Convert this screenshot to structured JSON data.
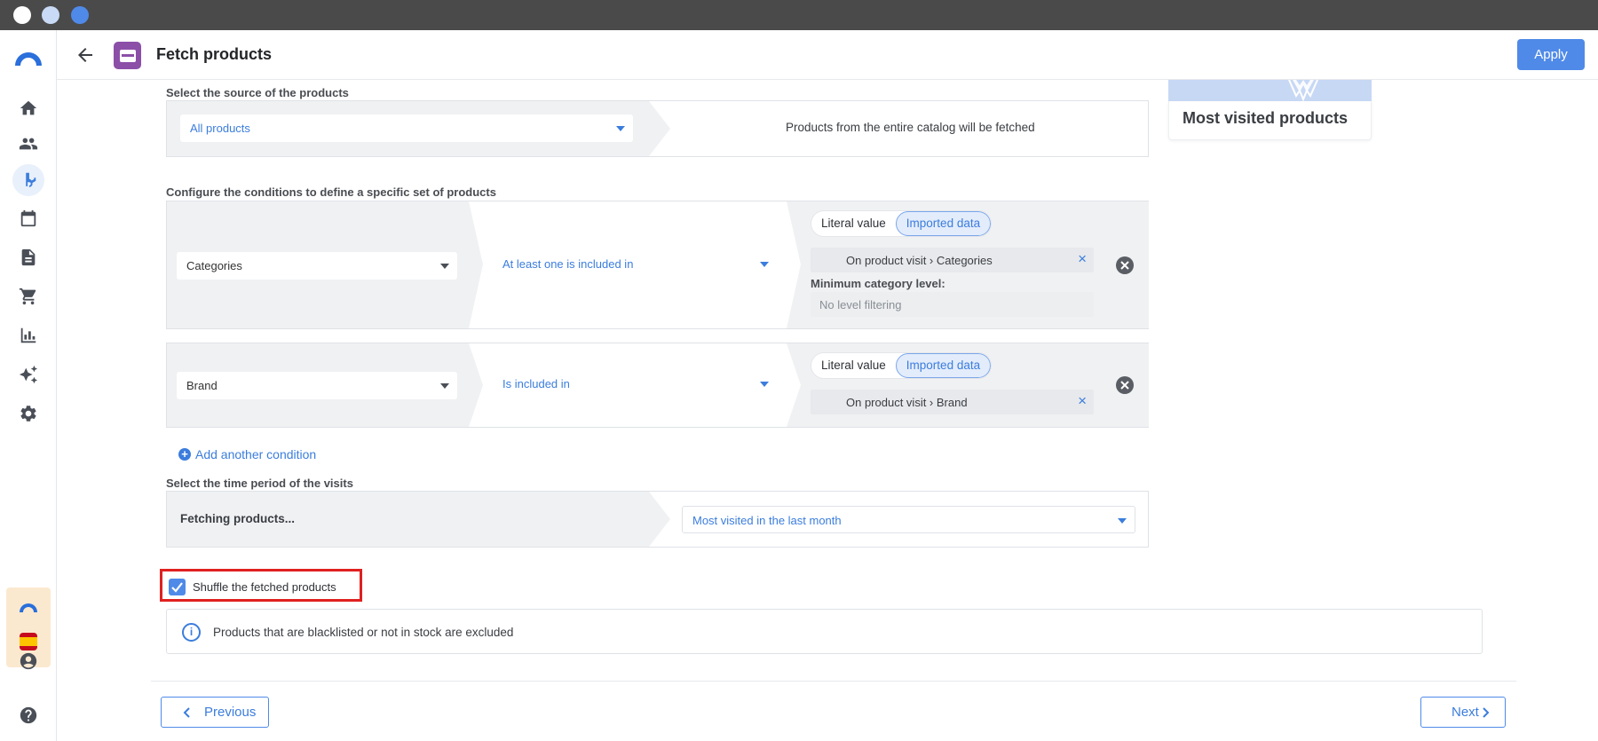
{
  "header": {
    "title": "Fetch products",
    "apply_label": "Apply"
  },
  "preview_card": {
    "title": "Most visited products"
  },
  "source": {
    "label": "Select the source of the products",
    "selected": "All products",
    "description": "Products from the entire catalog will be fetched"
  },
  "conditions": {
    "label": "Configure the conditions to define a specific set of products",
    "items": [
      {
        "field": "Categories",
        "operator": "At least one is included in",
        "toggle": [
          "Literal value",
          "Imported data"
        ],
        "toggle_selected": "Imported data",
        "value_chip": "On product visit › Categories",
        "min_level_label": "Minimum category level:",
        "min_level_value": "No level filtering"
      },
      {
        "field": "Brand",
        "operator": "Is included in",
        "toggle": [
          "Literal value",
          "Imported data"
        ],
        "toggle_selected": "Imported data",
        "value_chip": "On product visit › Brand"
      }
    ],
    "add_label": "Add another condition"
  },
  "time_period": {
    "label": "Select the time period of the visits",
    "left_text": "Fetching products...",
    "selected": "Most visited in the last month"
  },
  "shuffle": {
    "label": "Shuffle the fetched products",
    "checked": true
  },
  "info": {
    "text": "Products that are blacklisted or not in stock are excluded"
  },
  "footer": {
    "previous_label": "Previous",
    "next_label": "Next"
  },
  "sidebar": {
    "icons": [
      "home-icon",
      "people-icon",
      "workflow-icon",
      "calendar-icon",
      "document-icon",
      "cart-icon",
      "bar-chart-icon",
      "sparkle-icon",
      "gear-icon"
    ],
    "active": "workflow-icon",
    "bottom_icons": [
      "account-icon",
      "help-icon"
    ]
  },
  "colors": {
    "accent": "#4f8ae8",
    "badge": "#8b4fa8",
    "highlight_border": "#e02020"
  }
}
